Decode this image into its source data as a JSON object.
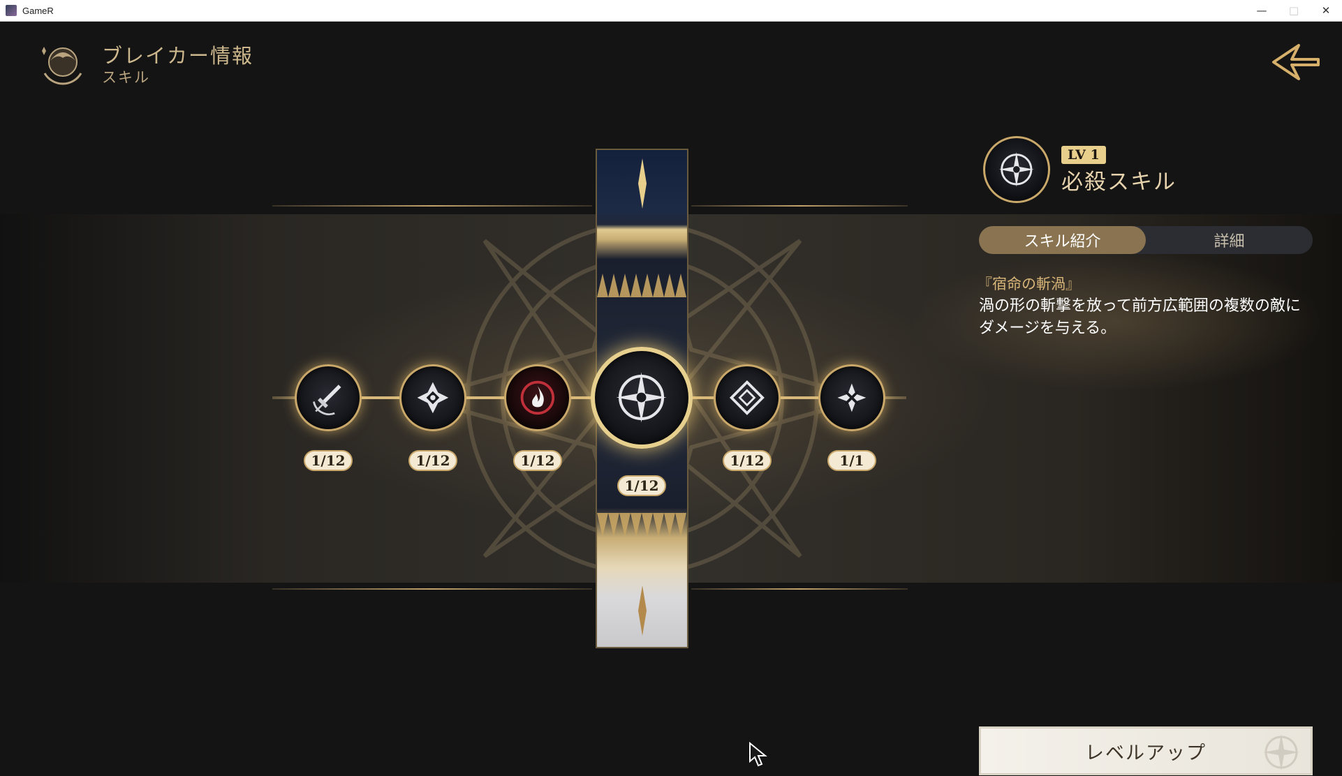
{
  "window": {
    "title": "GameR",
    "minimize_icon": "minimize-icon",
    "maximize_icon": "maximize-icon",
    "close_icon": "close-icon"
  },
  "header": {
    "title": "ブレイカー情報",
    "subtitle": "スキル",
    "emblem_icon": "character-emblem-icon",
    "back_icon": "back-arrow-icon"
  },
  "skills": [
    {
      "icon": "sword-icon",
      "level": "1/12"
    },
    {
      "icon": "diamond-cross-icon",
      "level": "1/12"
    },
    {
      "icon": "flame-icon",
      "level": "1/12"
    },
    {
      "icon": "compass-star-icon",
      "level": "1/12",
      "selected": true
    },
    {
      "icon": "rhombus-icon",
      "level": "1/12"
    },
    {
      "icon": "spiral-icon",
      "level": "1/1"
    }
  ],
  "detail": {
    "level": "LV 1",
    "type": "必殺スキル",
    "tabs": [
      {
        "label": "スキル紹介",
        "active": true
      },
      {
        "label": "詳細",
        "active": false
      }
    ],
    "skill_name": "『宿命の斬渦』",
    "description": "渦の形の斬撃を放って前方広範囲の複数の敵にダメージを与える。"
  },
  "actions": {
    "level_up": "レベルアップ"
  },
  "colors": {
    "gold": "#c9a86a",
    "accent_tab": "#8a7350",
    "text_gold": "#cdb78d"
  }
}
